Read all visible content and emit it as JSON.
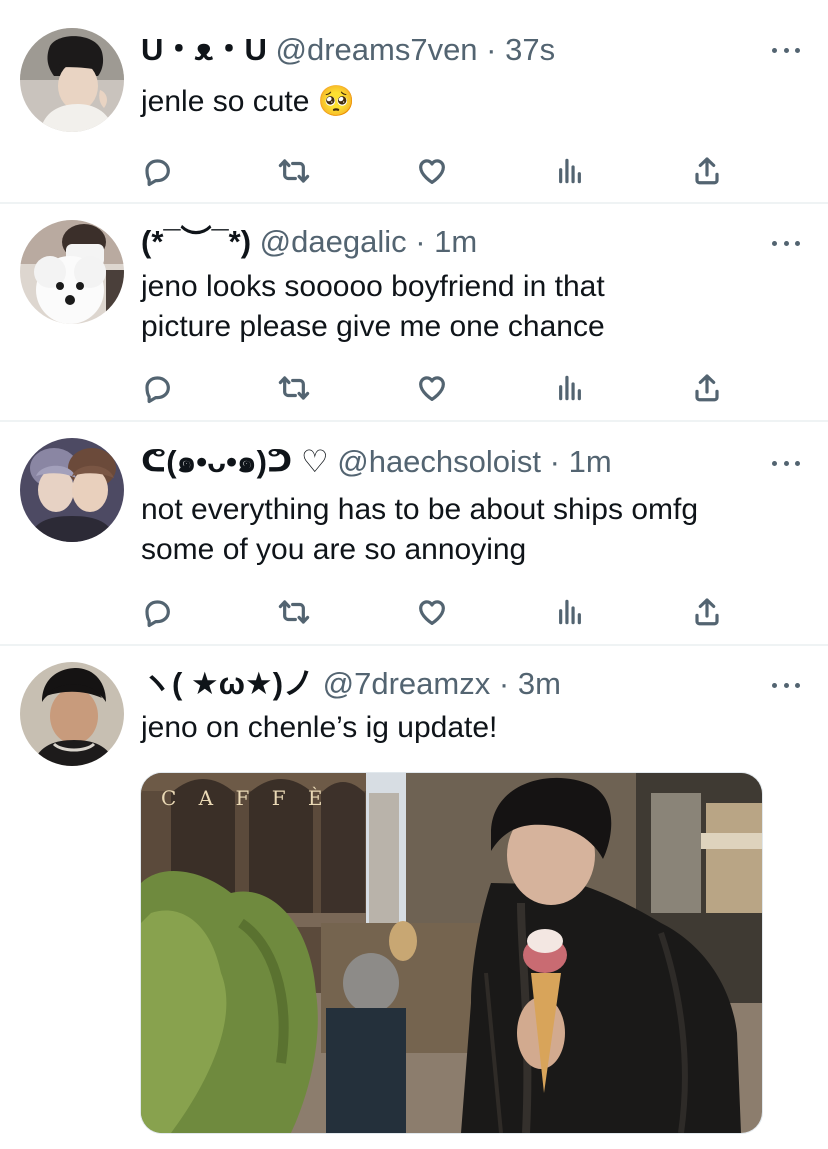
{
  "tweets": [
    {
      "name": "U・ᴥ・U",
      "handle": "@dreams7ven",
      "time": "37s",
      "text": "jenle so cute 🥺"
    },
    {
      "name": "(*¯︶¯*)",
      "handle": "@daegalic",
      "time": "1m",
      "text": "jeno looks sooooo boyfriend in that\npicture please give me one chance"
    },
    {
      "name": "ᕦ(๑•ᴗ•๑)ᕤ ♡",
      "handle": "@haechsoloist",
      "time": "1m",
      "text": "not everything has to be about ships omfg\nsome of you are so annoying"
    },
    {
      "name": "ヽ( ★ω★)ノ",
      "handle": "@7dreamzx",
      "time": "3m",
      "text": "jeno on chenle’s ig update!",
      "media_sign": "C A F F È"
    }
  ],
  "separator": "·",
  "colors": {
    "text": "#0f1419",
    "secondary": "#536471",
    "divider": "#eff3f4"
  },
  "icons": [
    "reply-icon",
    "retweet-icon",
    "like-icon",
    "views-icon",
    "share-icon",
    "more-icon"
  ]
}
